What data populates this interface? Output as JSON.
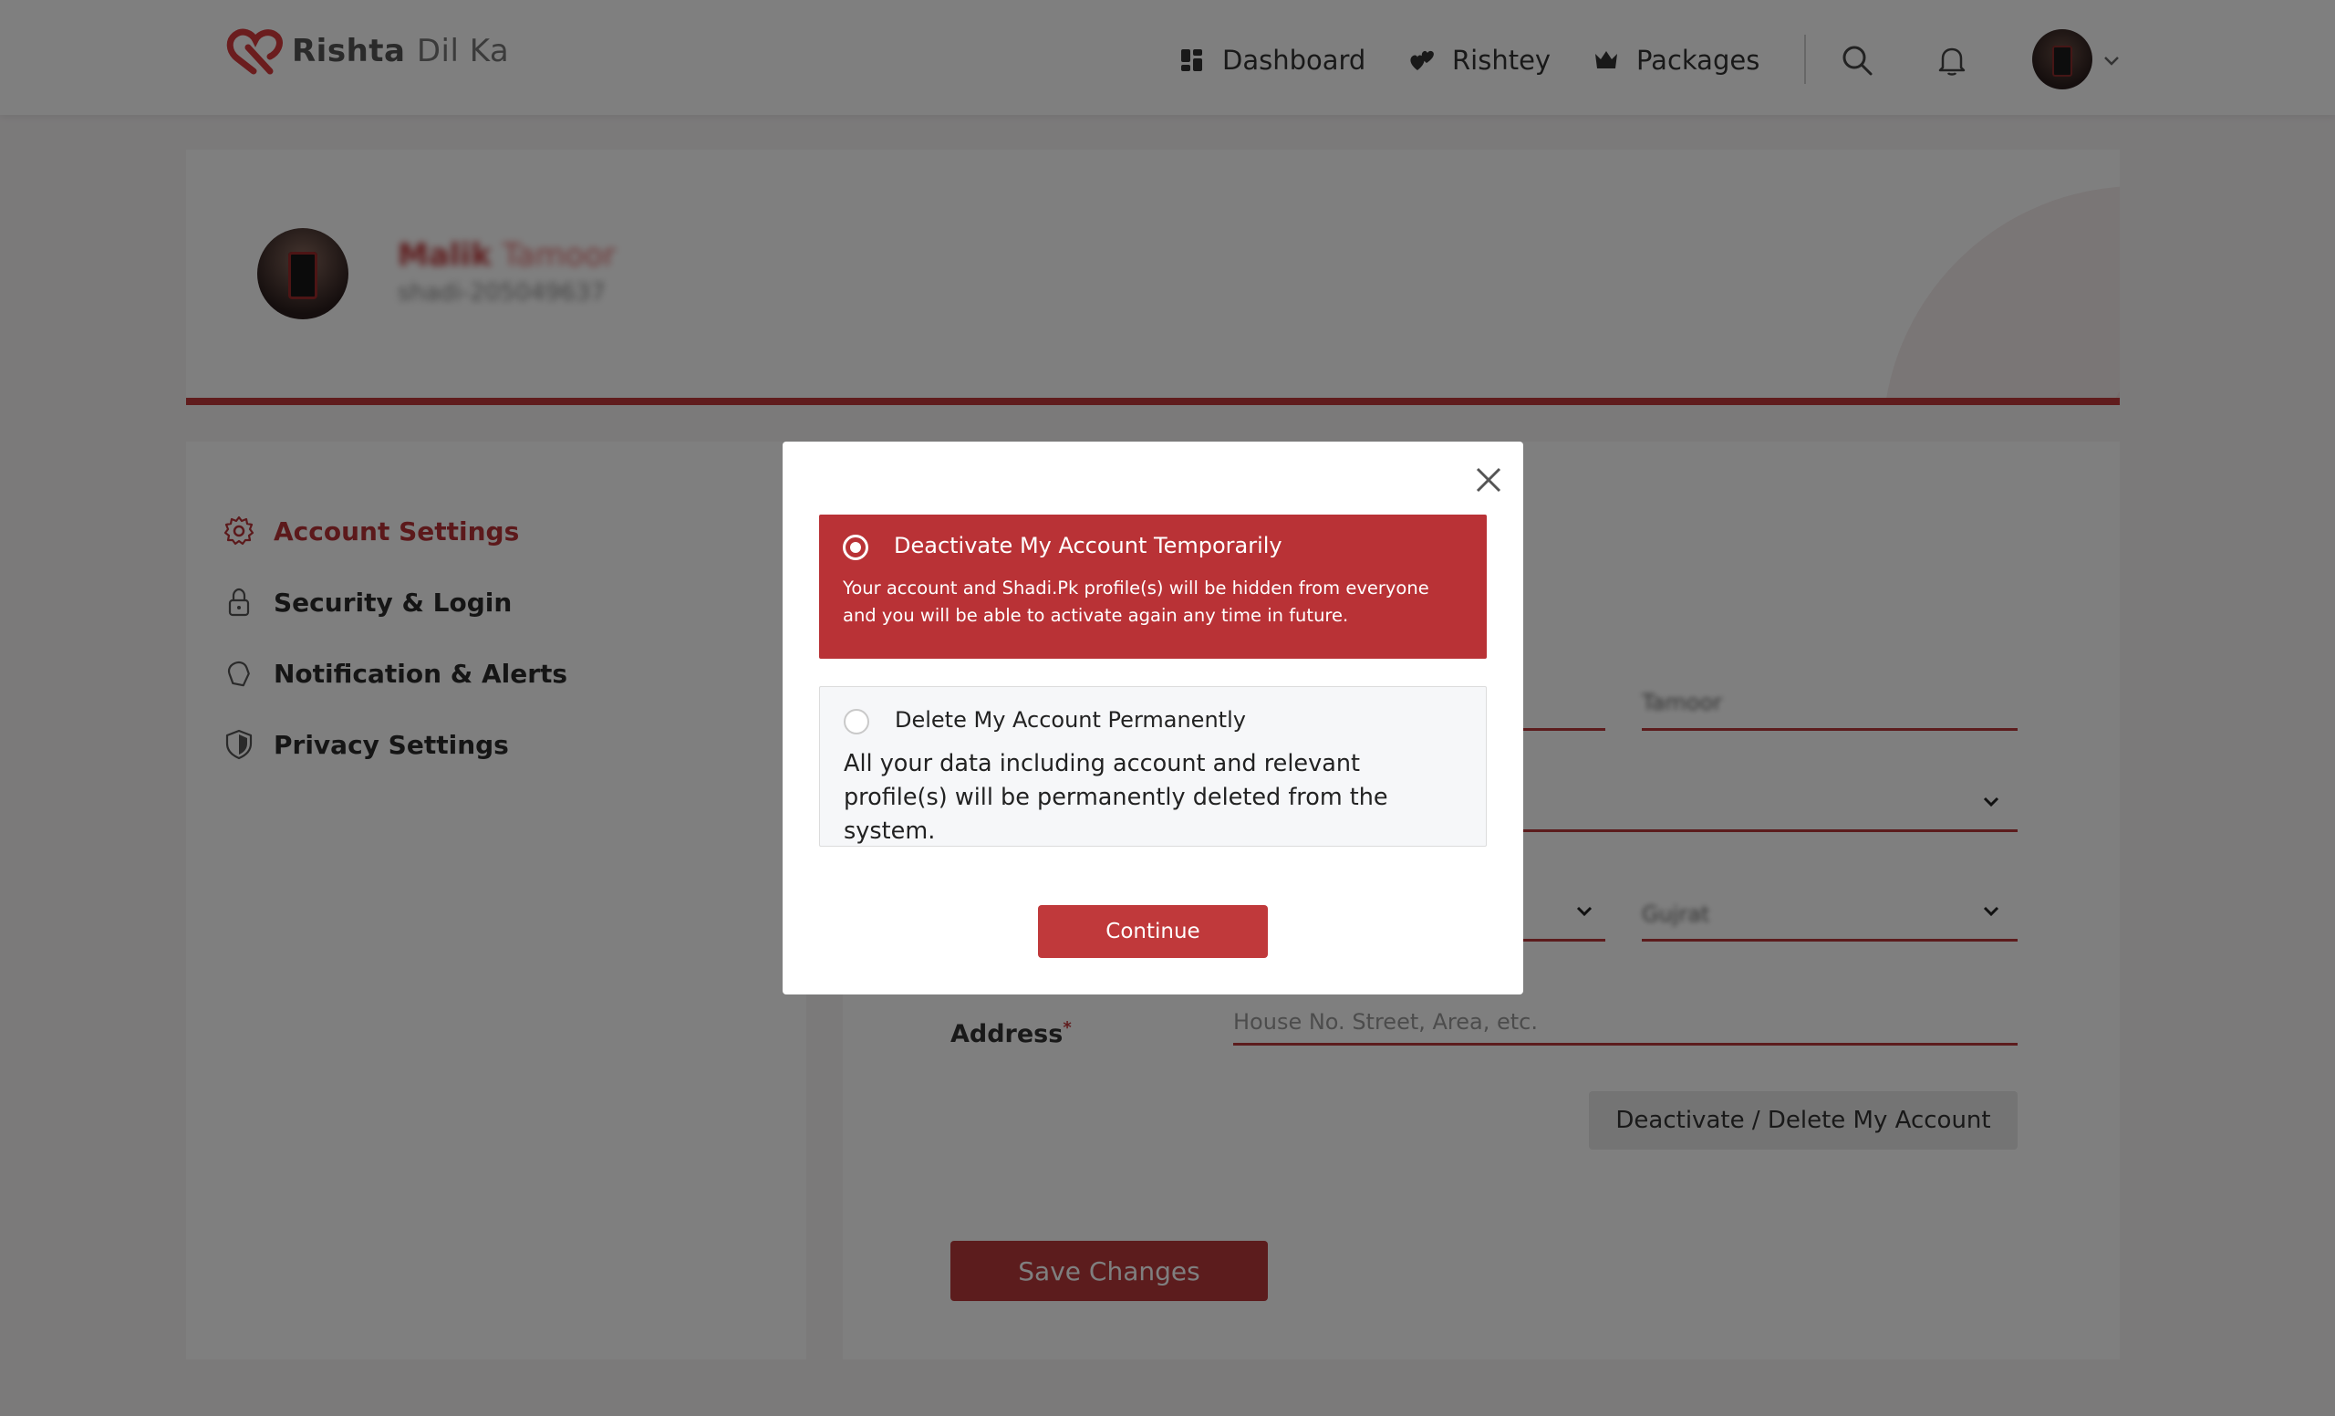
{
  "brand": {
    "name_bold": "Rishta",
    "name_light": "Dil Ka"
  },
  "nav": {
    "dashboard": "Dashboard",
    "rishtey": "Rishtey",
    "packages": "Packages"
  },
  "profile": {
    "first_name": "Malik",
    "last_name": "Tamoor",
    "id": "shadi-205049637"
  },
  "sidebar": {
    "items": [
      {
        "label": "Account Settings",
        "icon": "gear-icon",
        "active": true
      },
      {
        "label": "Security & Login",
        "icon": "lock-icon"
      },
      {
        "label": "Notification & Alerts",
        "icon": "bell-icon"
      },
      {
        "label": "Privacy Settings",
        "icon": "shield-icon"
      }
    ]
  },
  "form": {
    "last_name_value": "Tamoor",
    "city_value": "Gujrat",
    "address_label": "Address",
    "address_required": "*",
    "address_placeholder": "House No. Street, Area, etc.",
    "deactivate_button": "Deactivate / Delete My Account",
    "save_button": "Save Changes"
  },
  "modal": {
    "option_deactivate": {
      "title": "Deactivate My Account Temporarily",
      "description": "Your account and Shadi.Pk profile(s) will be hidden from everyone and you will be able to activate again any time in future.",
      "selected": true
    },
    "option_delete": {
      "title": "Delete My Account Permanently",
      "description": "All your data including account and relevant profile(s) will be permanently deleted from the system.",
      "selected": false
    },
    "continue_button": "Continue"
  },
  "colors": {
    "brand_red": "#c0393b",
    "overlay": "rgba(0,0,0,0.5)"
  }
}
